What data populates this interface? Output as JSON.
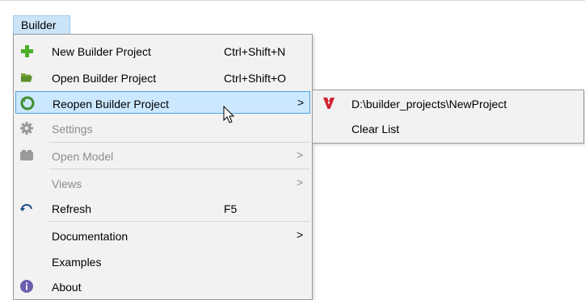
{
  "menubar": {
    "builder_label": "Builder"
  },
  "menu": {
    "items": [
      {
        "label": "New Builder Project",
        "shortcut": "Ctrl+Shift+N",
        "icon": "plus-icon",
        "enabled": true
      },
      {
        "label": "Open Builder Project",
        "shortcut": "Ctrl+Shift+O",
        "icon": "folder-open-icon",
        "enabled": true
      },
      {
        "label": "Reopen Builder Project",
        "submenu_arrow": ">",
        "icon": "reopen-icon",
        "enabled": true,
        "highlighted": true
      },
      {
        "label": "Settings",
        "icon": "gear-icon",
        "enabled": false
      },
      {
        "label": "Open Model",
        "submenu_arrow": ">",
        "icon": "model-icon",
        "enabled": false
      },
      {
        "label": "Views",
        "submenu_arrow": ">",
        "enabled": false
      },
      {
        "label": "Refresh",
        "shortcut": "F5",
        "icon": "refresh-icon",
        "enabled": true
      },
      {
        "label": "Documentation",
        "submenu_arrow": ">",
        "enabled": true
      },
      {
        "label": "Examples",
        "enabled": true
      },
      {
        "label": "About",
        "icon": "info-icon",
        "enabled": true
      }
    ]
  },
  "submenu": {
    "items": [
      {
        "label": "D:\\builder_projects\\NewProject",
        "icon": "project-logo-icon"
      },
      {
        "label": "Clear List"
      }
    ]
  },
  "colors": {
    "highlight_bg": "#cce8ff",
    "highlight_border": "#4aa3e0",
    "disabled_text": "#8c8c8c",
    "plus_green": "#4caf2a",
    "logo_red": "#d1202f",
    "info_purple": "#6a5fb0"
  }
}
